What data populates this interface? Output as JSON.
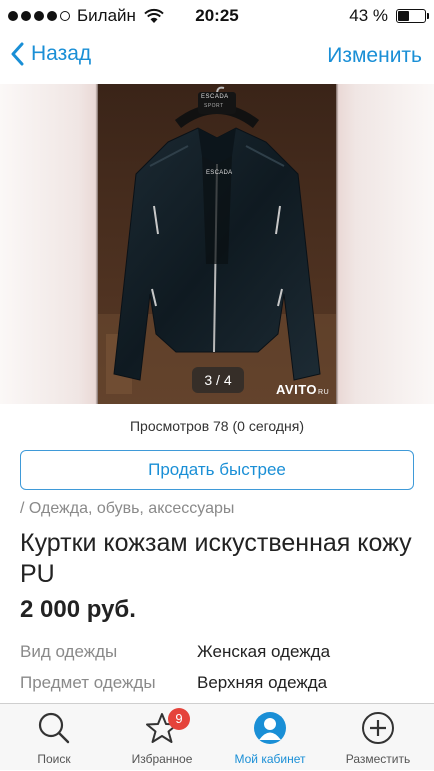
{
  "status_bar": {
    "carrier": "Билайн",
    "time": "20:25",
    "battery_text": "43 %",
    "battery_level": 0.43,
    "signal_bars_filled": 4,
    "signal_bars_total": 5
  },
  "nav": {
    "back_label": "Назад",
    "edit_label": "Изменить"
  },
  "photo": {
    "counter": "3 / 4",
    "watermark": "AVITO",
    "watermark_suffix": "RU",
    "label_top": "ESCADA",
    "label_sub": "SPORT",
    "collar_tag": "ESCADA"
  },
  "listing": {
    "views": "Просмотров 78 (0 сегодня)",
    "sell_faster_label": "Продать быстрее",
    "breadcrumb": "/ Одежда, обувь, аксессуары",
    "title": "Куртки кожзам искуственная кожу PU",
    "price": "2 000 руб.",
    "params": [
      {
        "label": "Вид одежды",
        "value": "Женская одежда"
      },
      {
        "label": "Предмет одежды",
        "value": "Верхняя одежда"
      }
    ]
  },
  "tab_bar": {
    "tabs": [
      {
        "label": "Поиск",
        "icon": "search-icon"
      },
      {
        "label": "Избранное",
        "icon": "star-icon",
        "badge": "9"
      },
      {
        "label": "Мой кабинет",
        "icon": "user-icon",
        "active": true
      },
      {
        "label": "Разместить",
        "icon": "plus-circle-icon"
      }
    ]
  },
  "colors": {
    "accent": "#1a8fd6",
    "badge": "#e5433b"
  }
}
